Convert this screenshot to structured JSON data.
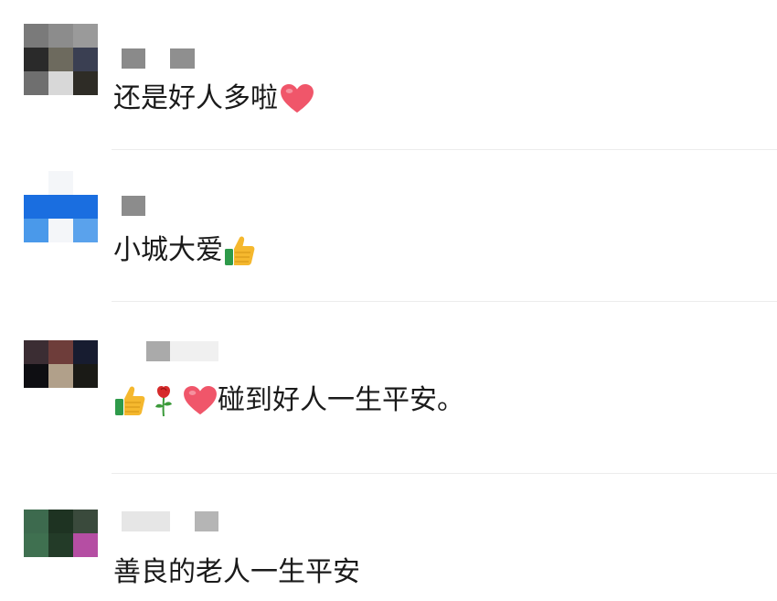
{
  "comments": [
    {
      "text": "还是好人多啦",
      "trailing_emoji": [
        "heart"
      ],
      "avatar_colors": [
        "#7a7a7a",
        "#8c8c8c",
        "#9a9a9a",
        "#2a2a2a",
        "#6d6a5e",
        "#3a3f52",
        "#6f6f6f",
        "#d8d8d8",
        "#2e2c26"
      ],
      "name_blocks": [
        "#8a8a8a",
        "#8f8f8f"
      ]
    },
    {
      "text": "小城大爱",
      "trailing_emoji": [
        "thumbs-up"
      ],
      "avatar_colors": [
        "#ffffff",
        "#f4f6f9",
        "#ffffff",
        "#1a6ee0",
        "#1a6ee0",
        "#1a6ee0",
        "#4a99ea",
        "#f4f6f9",
        "#5aa2ec"
      ],
      "name_blocks": [
        "#8c8c8c"
      ]
    },
    {
      "text": "碰到好人一生平安。",
      "leading_emoji": [
        "thumbs-up",
        "rose",
        "heart"
      ],
      "avatar_colors": [
        "#3b2d33",
        "#6e3d3a",
        "#171c30",
        "#0e0e12",
        "#b1a08a",
        "#1a1a16",
        "#ffffff",
        "#ffffff",
        "#ffffff"
      ],
      "name_blocks": [
        "#aaaaaa",
        "#f0f0f0"
      ]
    },
    {
      "text": "善良的老人一生平安",
      "trailing_emoji": [],
      "avatar_colors": [
        "#3d6a4e",
        "#1e3322",
        "#3a4a3c",
        "#3f7050",
        "#233b28",
        "#b54ea3",
        "#ffffff",
        "#ffffff",
        "#ffffff"
      ],
      "name_blocks": [
        "#e6e6e6",
        "#b5b5b5"
      ]
    }
  ],
  "colors": {
    "text": "#1a1a1a",
    "divider": "#ececec",
    "heart": "#f0566a",
    "thumb": "#f5b82e",
    "cuff": "#2e9a4a",
    "rose": "#d62b2b",
    "stem": "#3b9a3a"
  }
}
